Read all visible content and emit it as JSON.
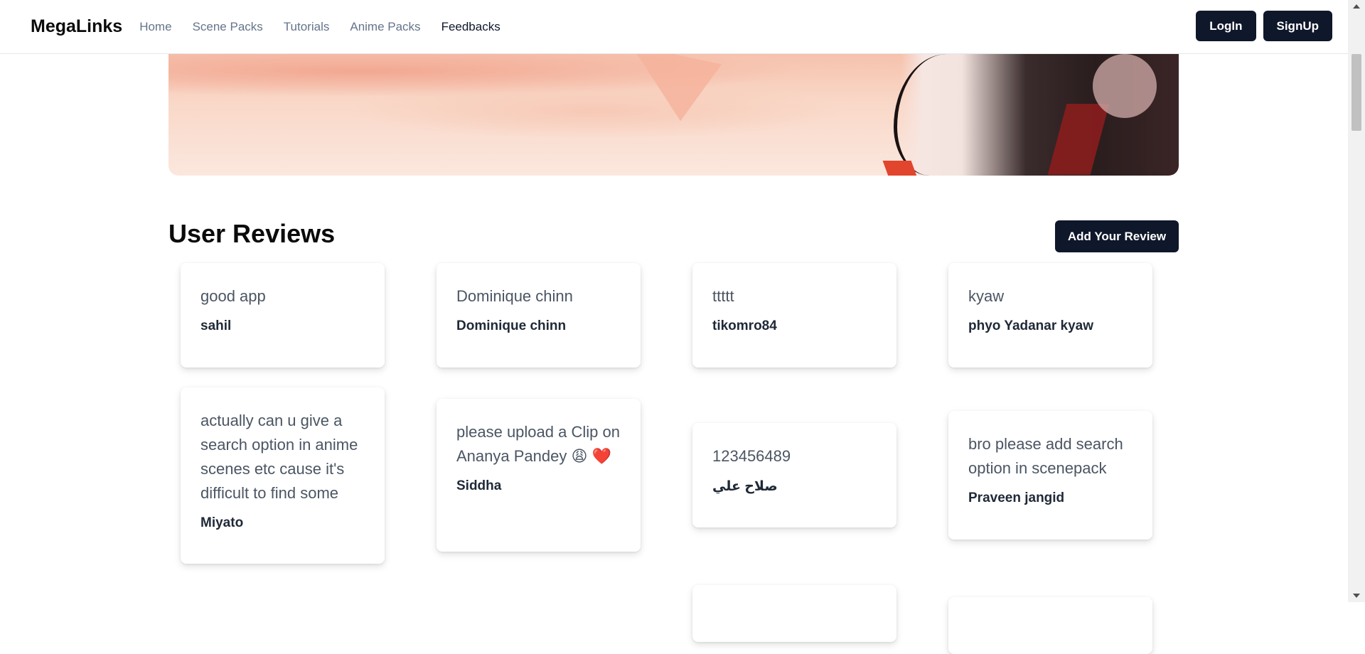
{
  "header": {
    "brand": "MegaLinks",
    "nav": [
      "Home",
      "Scene Packs",
      "Tutorials",
      "Anime Packs",
      "Feedbacks"
    ],
    "active_nav": "Feedbacks",
    "login_label": "LogIn",
    "signup_label": "SignUp"
  },
  "section": {
    "title": "User Reviews",
    "add_review_label": "Add Your Review"
  },
  "reviews": [
    {
      "message": "good app",
      "author": "sahil"
    },
    {
      "message": "Dominique chinn",
      "author": "Dominique chinn"
    },
    {
      "message": "ttttt",
      "author": "tikomro84"
    },
    {
      "message": "kyaw",
      "author": "phyo Yadanar kyaw"
    },
    {
      "message": "actually can u give a search option in anime scenes etc cause it's difficult to find some",
      "author": "Miyato"
    },
    {
      "message": "please upload a Clip on Ananya Pandey 😩 ❤️",
      "author": "Siddha"
    },
    {
      "message": "123456489",
      "author": "صلاح علي"
    },
    {
      "message": "bro please add search option in scenepack",
      "author": "Praveen jangid"
    }
  ],
  "colors": {
    "primary_button": "#0f172a",
    "nav_text": "#64748b",
    "active_nav_text": "#0f172a"
  }
}
